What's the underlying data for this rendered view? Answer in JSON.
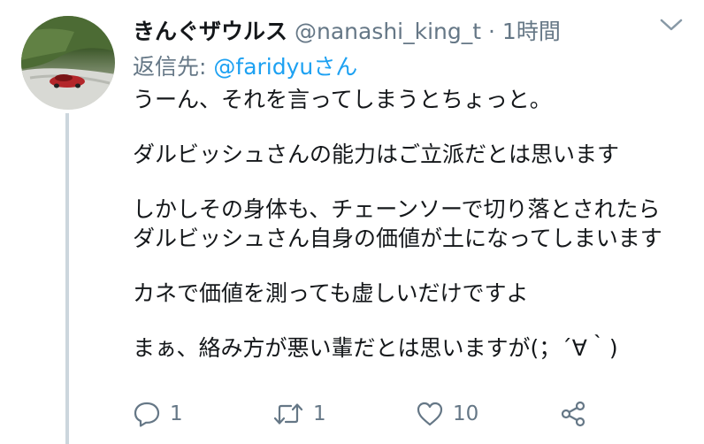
{
  "tweet": {
    "display_name": "きんぐザウルス",
    "handle": "@nanashi_king_t",
    "separator": "·",
    "time": "1時間",
    "reply_label": "返信先:",
    "reply_to": "@faridyuさん",
    "lines": [
      "うーん、それを言ってしまうとちょっと。",
      "",
      "ダルビッシュさんの能力はご立派だとは思います",
      "",
      "しかしその身体も、チェーンソーで切り落とされたら",
      "ダルビッシュさん自身の価値が土になってしまいます",
      "",
      "カネで価値を測っても虚しいだけですよ",
      "",
      "まぁ、絡み方が悪い輩だとは思いますが(；´∀｀)"
    ]
  },
  "actions": {
    "reply_count": "1",
    "retweet_count": "1",
    "like_count": "10"
  },
  "icons": {
    "reply": "speech-bubble-icon",
    "retweet": "retweet-arrows-icon",
    "like": "heart-icon",
    "share": "share-icon",
    "menu": "chevron-down-icon"
  },
  "colors": {
    "text": "#14171a",
    "muted": "#657786",
    "link": "#1da1f2",
    "thread_line": "#ccd6dd"
  }
}
